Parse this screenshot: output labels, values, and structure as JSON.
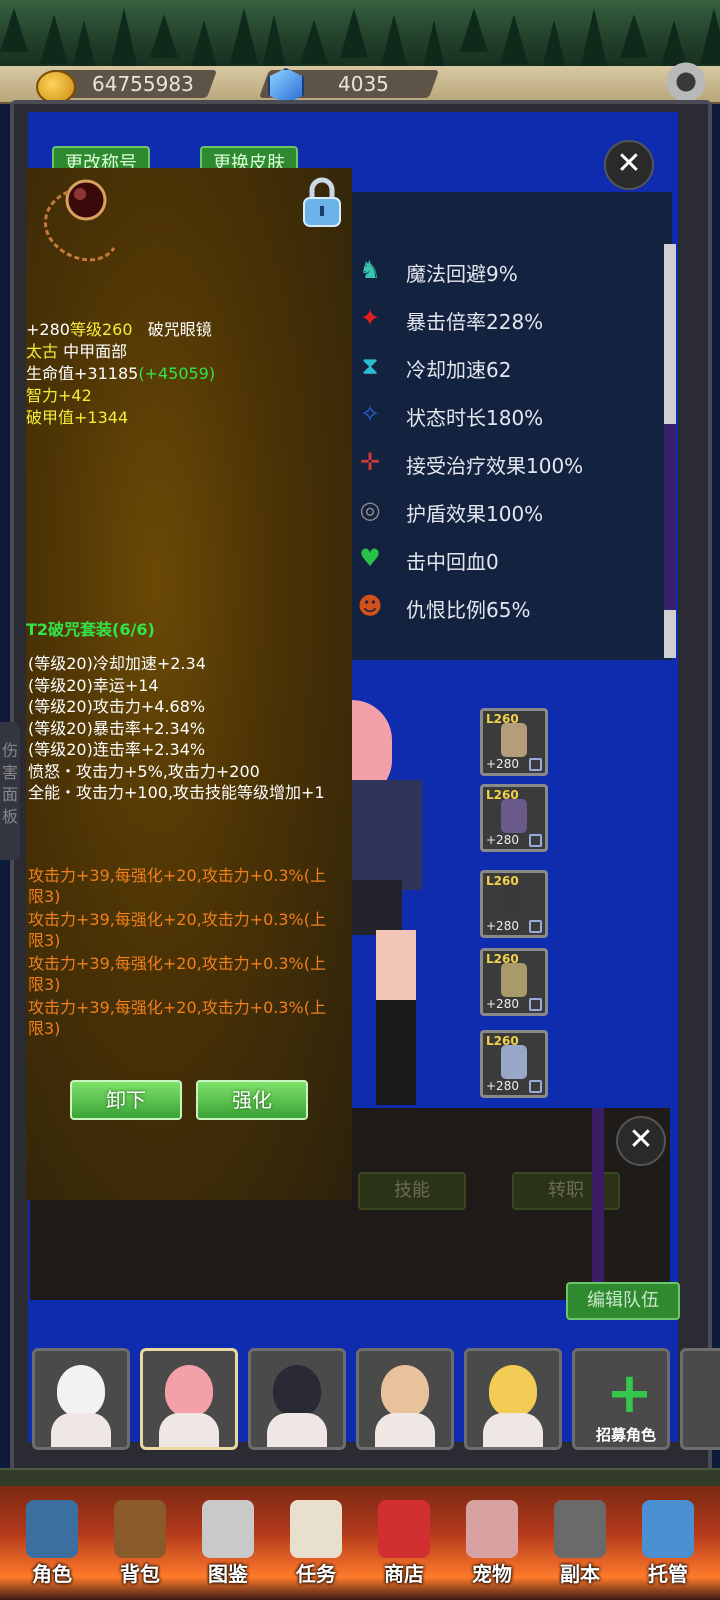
{
  "currency": {
    "gold": "64755983",
    "gems": "4035"
  },
  "profile_buttons": {
    "rename": "更改称号",
    "skin": "更换皮肤"
  },
  "stats": [
    {
      "icon": "magic-dodge-icon",
      "text": "魔法回避9%",
      "color": "#39c6b0"
    },
    {
      "icon": "crit-multiplier-icon",
      "text": "暴击倍率228%",
      "color": "#e02020"
    },
    {
      "icon": "cooldown-icon",
      "text": "冷却加速62",
      "color": "#2dbbd0"
    },
    {
      "icon": "status-duration-icon",
      "text": "状态时长180%",
      "color": "#2e5fd8"
    },
    {
      "icon": "heal-received-icon",
      "text": "接受治疗效果100%",
      "color": "#d33a3a"
    },
    {
      "icon": "shield-effect-icon",
      "text": "护盾效果100%",
      "color": "#8a8a8a"
    },
    {
      "icon": "lifesteal-icon",
      "text": "击中回血0",
      "color": "#2ac34a"
    },
    {
      "icon": "threat-icon",
      "text": "仇恨比例65%",
      "color": "#d3501a"
    }
  ],
  "equipment_slots": [
    {
      "level": "L260",
      "plus": "+280",
      "item_color": "#b59c7a"
    },
    {
      "level": "L260",
      "plus": "+280",
      "item_color": "#6a5a8a"
    },
    {
      "level": "L260",
      "plus": "+280",
      "item_color": "#3a3a3a"
    },
    {
      "level": "L260",
      "plus": "+280",
      "item_color": "#a89a6a"
    },
    {
      "level": "L260",
      "plus": "+280",
      "item_color": "#9aa8c8"
    }
  ],
  "lower_tabs": {
    "skills": "技能",
    "job_change": "转职",
    "edit_team": "编辑队伍"
  },
  "side_tab": "伤害面板",
  "heroes": [
    {
      "hair": "#f2f2f2"
    },
    {
      "hair": "#f4a0a8"
    },
    {
      "hair": "#2a2a35"
    },
    {
      "hair": "#e8c29a"
    },
    {
      "hair": "#f2cc55"
    }
  ],
  "recruit_label": "招募角色",
  "nav": [
    {
      "label": "角色",
      "icon": "helmet-icon",
      "color": "#3a6fa0"
    },
    {
      "label": "背包",
      "icon": "backpack-icon",
      "color": "#8a5a2a"
    },
    {
      "label": "图鉴",
      "icon": "book-icon",
      "color": "#c9c9c9"
    },
    {
      "label": "任务",
      "icon": "scroll-icon",
      "color": "#e8e0cc"
    },
    {
      "label": "商店",
      "icon": "shop-icon",
      "color": "#d23030"
    },
    {
      "label": "宠物",
      "icon": "meat-icon",
      "color": "#d9a2a2"
    },
    {
      "label": "副本",
      "icon": "skull-gate-icon",
      "color": "#6a6a6a"
    },
    {
      "label": "托管",
      "icon": "calendar-icon",
      "color": "#4a90d0"
    }
  ],
  "tooltip": {
    "header_plus": "+280",
    "header_level": "等级260",
    "header_name": "破咒眼镜",
    "quality": "太古",
    "slot": "中甲面部",
    "hp": "生命值+31185",
    "hp_bonus": "(+45059)",
    "int": "智力+42",
    "armor_pen": "破甲值+1344",
    "set_name": "T2破咒套装(6/6)",
    "set_bonuses": [
      "(等级20)冷却加速+2.34",
      "(等级20)幸运+14",
      "(等级20)攻击力+4.68%",
      "(等级20)暴击率+2.34%",
      "(等级20)连击率+2.34%",
      "愤怒・攻击力+5%,攻击力+200",
      "全能・攻击力+100,攻击技能等级增加+1"
    ],
    "enchants": [
      {
        "l1": "攻击力+39,每强化+20,攻击力+0.3%(上",
        "l2": "限3)"
      },
      {
        "l1": "攻击力+39,每强化+20,攻击力+0.3%(上",
        "l2": "限3)"
      },
      {
        "l1": "攻击力+39,每强化+20,攻击力+0.3%(上",
        "l2": "限3)"
      },
      {
        "l1": "攻击力+39,每强化+20,攻击力+0.3%(上",
        "l2": "限3)"
      }
    ],
    "unequip_label": "卸下",
    "enhance_label": "强化"
  }
}
